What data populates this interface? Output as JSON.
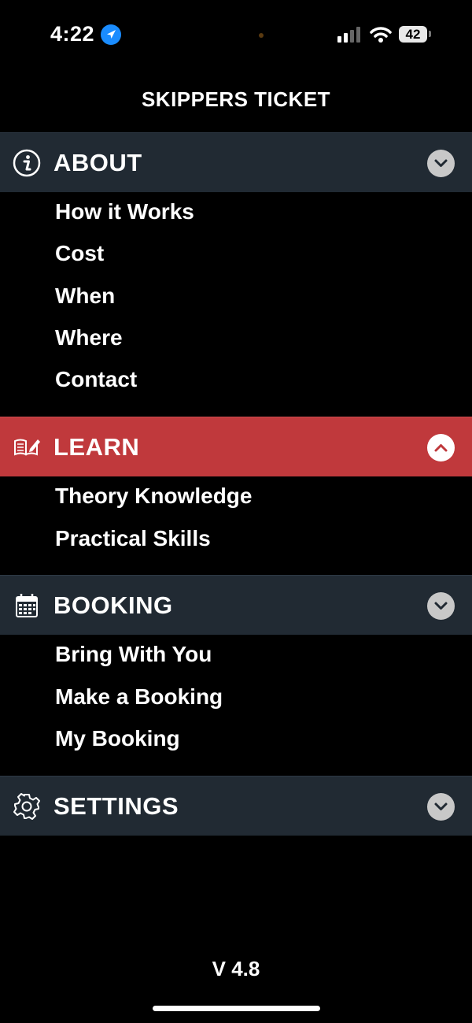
{
  "status_bar": {
    "time": "4:22",
    "battery": "42"
  },
  "header": {
    "title": "SKIPPERS TICKET"
  },
  "sections": [
    {
      "label": "ABOUT",
      "icon": "info-icon",
      "expanded": true,
      "items": [
        "How it Works",
        "Cost",
        "When",
        "Where",
        "Contact"
      ]
    },
    {
      "label": "LEARN",
      "icon": "book-pencil-icon",
      "expanded": true,
      "active": true,
      "items": [
        "Theory Knowledge",
        "Practical Skills"
      ]
    },
    {
      "label": "BOOKING",
      "icon": "calendar-icon",
      "expanded": true,
      "items": [
        "Bring With You",
        "Make a Booking",
        "My Booking"
      ]
    },
    {
      "label": "SETTINGS",
      "icon": "gear-icon",
      "expanded": false,
      "items": []
    }
  ],
  "footer": {
    "version": "V 4.8"
  },
  "colors": {
    "header_bg": "#212a33",
    "active_bg": "#c0393c",
    "background": "#000000"
  }
}
